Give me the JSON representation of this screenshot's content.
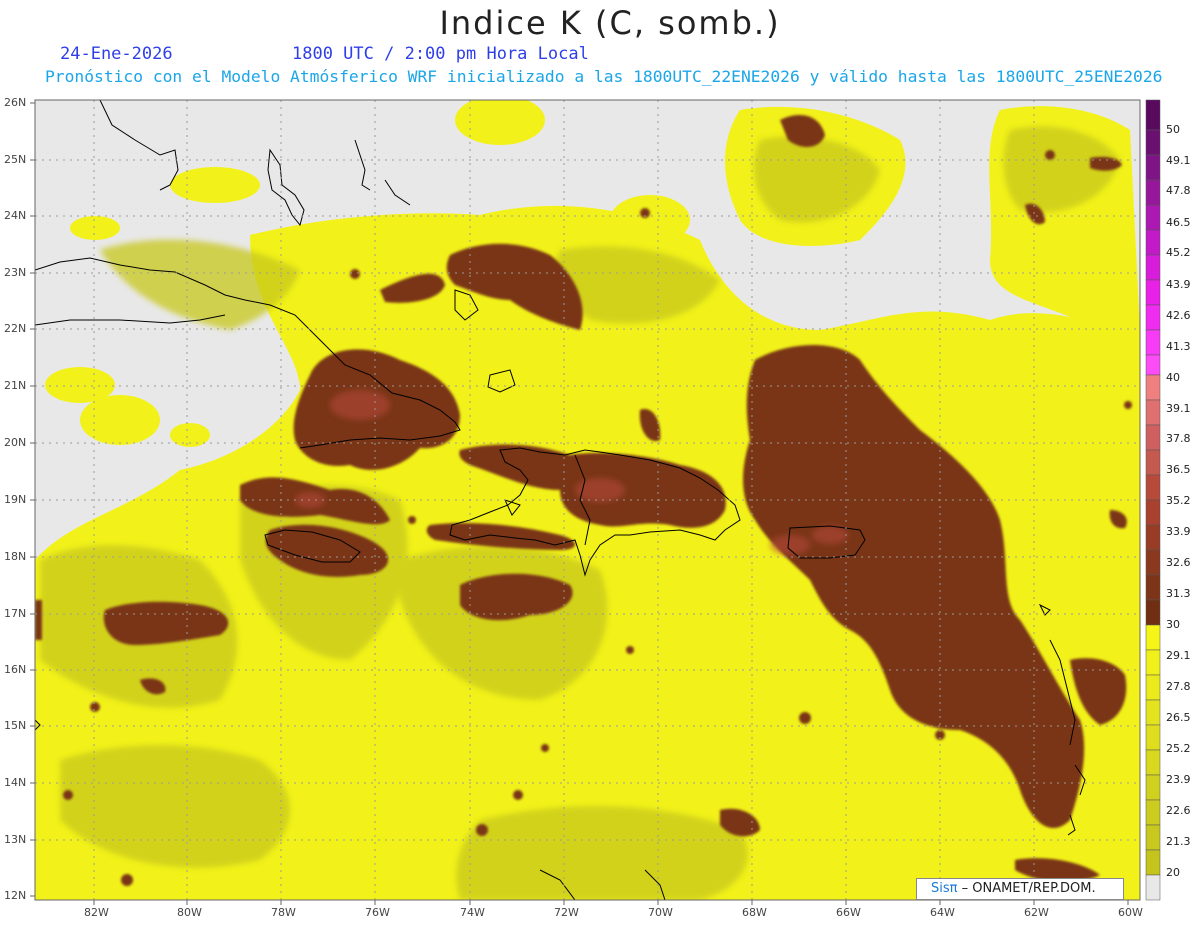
{
  "title": "Indice K (C, somb.)",
  "date_label": "24-Ene-2026",
  "time_label": "1800 UTC / 2:00 pm Hora Local",
  "forecast_label": "Pronóstico con el Modelo Atmósferico WRF inicializado a las 1800UTC_22ENE2026 y válido hasta las  1800UTC_25ENE2026",
  "lat_labels": [
    "26N",
    "25N",
    "24N",
    "23N",
    "22N",
    "21N",
    "20N",
    "19N",
    "18N",
    "17N",
    "16N",
    "15N",
    "14N",
    "13N",
    "12N"
  ],
  "lon_labels": [
    "82W",
    "80W",
    "78W",
    "76W",
    "74W",
    "72W",
    "70W",
    "68W",
    "66W",
    "64W",
    "62W",
    "60W"
  ],
  "colorbar_labels": [
    "50",
    "49.1",
    "47.8",
    "46.5",
    "45.2",
    "43.9",
    "42.6",
    "41.3",
    "40",
    "39.1",
    "37.8",
    "36.5",
    "35.2",
    "33.9",
    "32.6",
    "31.3",
    "30",
    "29.1",
    "27.8",
    "26.5",
    "25.2",
    "23.9",
    "22.6",
    "21.3",
    "20"
  ],
  "colors": {
    "background_map": "#e8e8e8",
    "yellow_bright": "#f2f21a",
    "yellow_olive": "#c8c81e",
    "brown": "#7a3418",
    "brown_light": "#b84a3c",
    "magenta": "#d21ad2",
    "purple": "#6a1070"
  },
  "credit": {
    "brand": "Sisπ",
    "text": "– ONAMET/REP.DOM."
  }
}
